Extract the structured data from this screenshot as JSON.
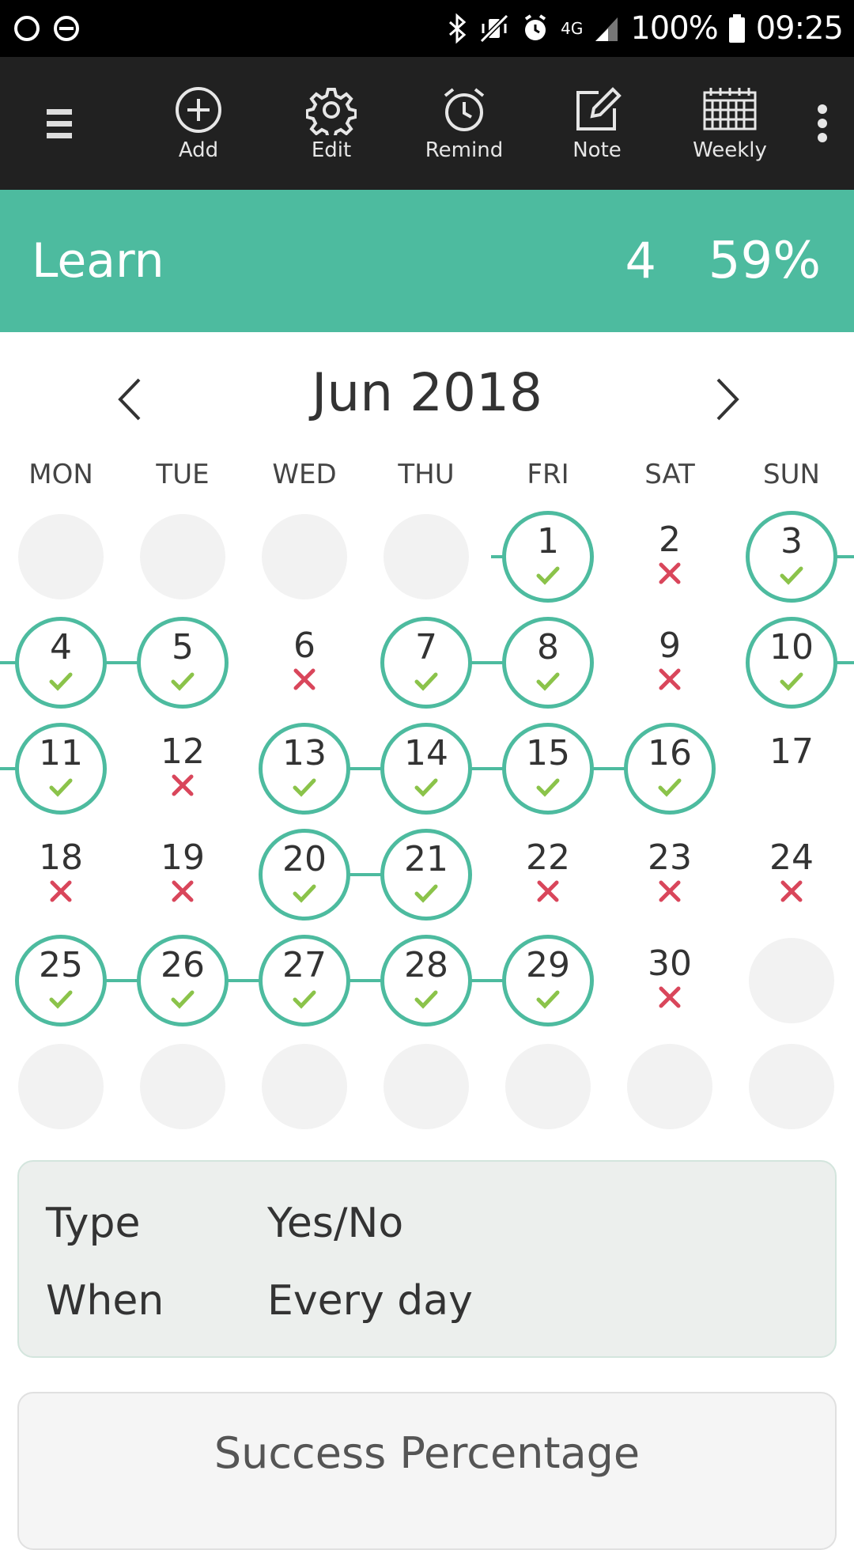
{
  "status_bar": {
    "battery_percent": "100%",
    "time": "09:25",
    "network": "4G",
    "left_icons": [
      "circle-icon",
      "do-not-disturb-icon"
    ],
    "right_icons": [
      "bluetooth-icon",
      "vibrate-mute-icon",
      "alarm-icon",
      "signal-icon",
      "battery-icon"
    ]
  },
  "toolbar": {
    "add_label": "Add",
    "edit_label": "Edit",
    "remind_label": "Remind",
    "note_label": "Note",
    "weekly_label": "Weekly"
  },
  "habit": {
    "name": "Learn",
    "streak": "4",
    "success_rate": "59%"
  },
  "calendar": {
    "month_label": "Jun 2018",
    "weekdays": [
      "MON",
      "TUE",
      "WED",
      "THU",
      "FRI",
      "SAT",
      "SUN"
    ],
    "rows": [
      [
        "",
        "",
        "",
        "",
        "1",
        "2",
        "3"
      ],
      [
        "4",
        "5",
        "6",
        "7",
        "8",
        "9",
        "10"
      ],
      [
        "11",
        "12",
        "13",
        "14",
        "15",
        "16",
        "17"
      ],
      [
        "18",
        "19",
        "20",
        "21",
        "22",
        "23",
        "24"
      ],
      [
        "25",
        "26",
        "27",
        "28",
        "29",
        "30",
        ""
      ],
      [
        "",
        "",
        "",
        "",
        "",
        "",
        ""
      ]
    ],
    "status": [
      [
        "empty",
        "empty",
        "empty",
        "empty",
        "done",
        "missed",
        "done"
      ],
      [
        "done",
        "done",
        "missed",
        "done",
        "done",
        "missed",
        "done"
      ],
      [
        "done",
        "missed",
        "done",
        "done",
        "done",
        "done",
        "none"
      ],
      [
        "missed",
        "missed",
        "done",
        "done",
        "missed",
        "missed",
        "missed"
      ],
      [
        "done",
        "done",
        "done",
        "done",
        "done",
        "missed",
        "empty"
      ],
      [
        "empty",
        "empty",
        "empty",
        "empty",
        "empty",
        "empty",
        "empty"
      ]
    ],
    "colors": {
      "accent": "#4dbb9f",
      "check": "#8bc34a",
      "cross": "#d9465b",
      "empty": "#f2f2f2"
    }
  },
  "info": {
    "type_label": "Type",
    "type_value": "Yes/No",
    "when_label": "When",
    "when_value": "Every day"
  },
  "success": {
    "title": "Success Percentage"
  }
}
